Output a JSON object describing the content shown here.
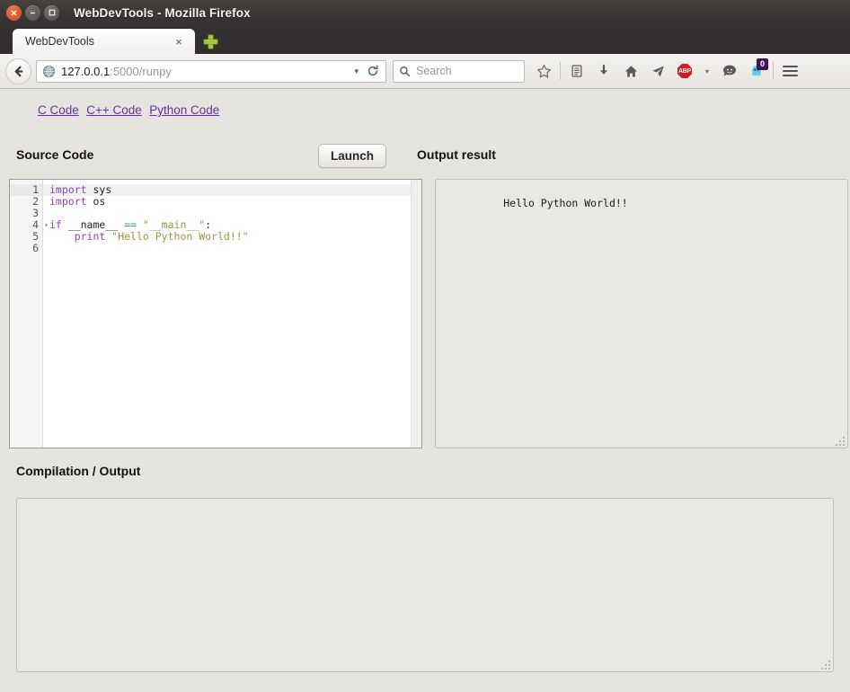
{
  "window": {
    "title": "WebDevTools - Mozilla Firefox",
    "close_label": "×",
    "minimize_label": "−",
    "maximize_label": "□"
  },
  "tabs": {
    "items": [
      {
        "label": "WebDevTools",
        "close_label": "×"
      }
    ],
    "new_tab_label": "+"
  },
  "navbar": {
    "back_label": "Back",
    "url_host": "127.0.0.1",
    "url_path": ":5000/runpy",
    "url_full": "127.0.0.1:5000/runpy",
    "dropdown_label": "▾",
    "reload_label": "⟳",
    "search_placeholder": "Search",
    "icons": [
      {
        "name": "bookmark-star-icon",
        "label": "Bookmark"
      },
      {
        "name": "reader-list-icon",
        "label": "Reading List"
      },
      {
        "name": "downloads-icon",
        "label": "Downloads"
      },
      {
        "name": "home-icon",
        "label": "Home"
      },
      {
        "name": "pocket-send-icon",
        "label": "Send"
      },
      {
        "name": "adblock-plus-icon",
        "label": "ABP"
      },
      {
        "name": "chat-bubble-icon",
        "label": "Chat"
      },
      {
        "name": "ghostery-icon",
        "label": "Ghostery"
      }
    ],
    "abp_label": "ABP",
    "ghostery_badge": "0",
    "menu_label": "Open menu"
  },
  "page": {
    "nav_links": [
      {
        "label": "C Code"
      },
      {
        "label": "C++ Code"
      },
      {
        "label": "Python Code"
      }
    ],
    "source_heading": "Source Code",
    "launch_label": "Launch",
    "output_heading": "Output result",
    "compilation_heading": "Compilation / Output",
    "editor": {
      "line_numbers": [
        "1",
        "2",
        "3",
        "4",
        "5",
        "6"
      ],
      "active_line": 1,
      "fold_line": 4,
      "fold_marker": "▾",
      "lines": [
        {
          "n": "1",
          "tokens": [
            {
              "t": "import",
              "c": "kw"
            },
            {
              "t": " sys",
              "c": "pl"
            }
          ]
        },
        {
          "n": "2",
          "tokens": [
            {
              "t": "import",
              "c": "kw"
            },
            {
              "t": " os",
              "c": "pl"
            }
          ]
        },
        {
          "n": "3",
          "tokens": []
        },
        {
          "n": "4",
          "tokens": [
            {
              "t": "if",
              "c": "kw"
            },
            {
              "t": " __name__ ",
              "c": "pl"
            },
            {
              "t": "==",
              "c": "op"
            },
            {
              "t": " ",
              "c": "pl"
            },
            {
              "t": "\"__main__\"",
              "c": "st"
            },
            {
              "t": ":",
              "c": "pl"
            }
          ]
        },
        {
          "n": "5",
          "tokens": [
            {
              "t": "    ",
              "c": "pl"
            },
            {
              "t": "print",
              "c": "kw"
            },
            {
              "t": " ",
              "c": "pl"
            },
            {
              "t": "\"Hello Python World!!\"",
              "c": "st"
            }
          ]
        },
        {
          "n": "6",
          "tokens": []
        }
      ],
      "plain_text": "import sys\nimport os\n\nif __name__ == \"__main__\":\n    print \"Hello Python World!!\""
    },
    "output_value": "Hello Python World!!",
    "compilation_value": ""
  },
  "colors": {
    "link": "#6a2ba0",
    "keyword": "#8e44ad",
    "operator": "#3a9aa8",
    "string": "#a0933a",
    "badge_bg": "#3b1456",
    "abp_red": "#d61b20",
    "page_bg": "#e6e4df"
  }
}
